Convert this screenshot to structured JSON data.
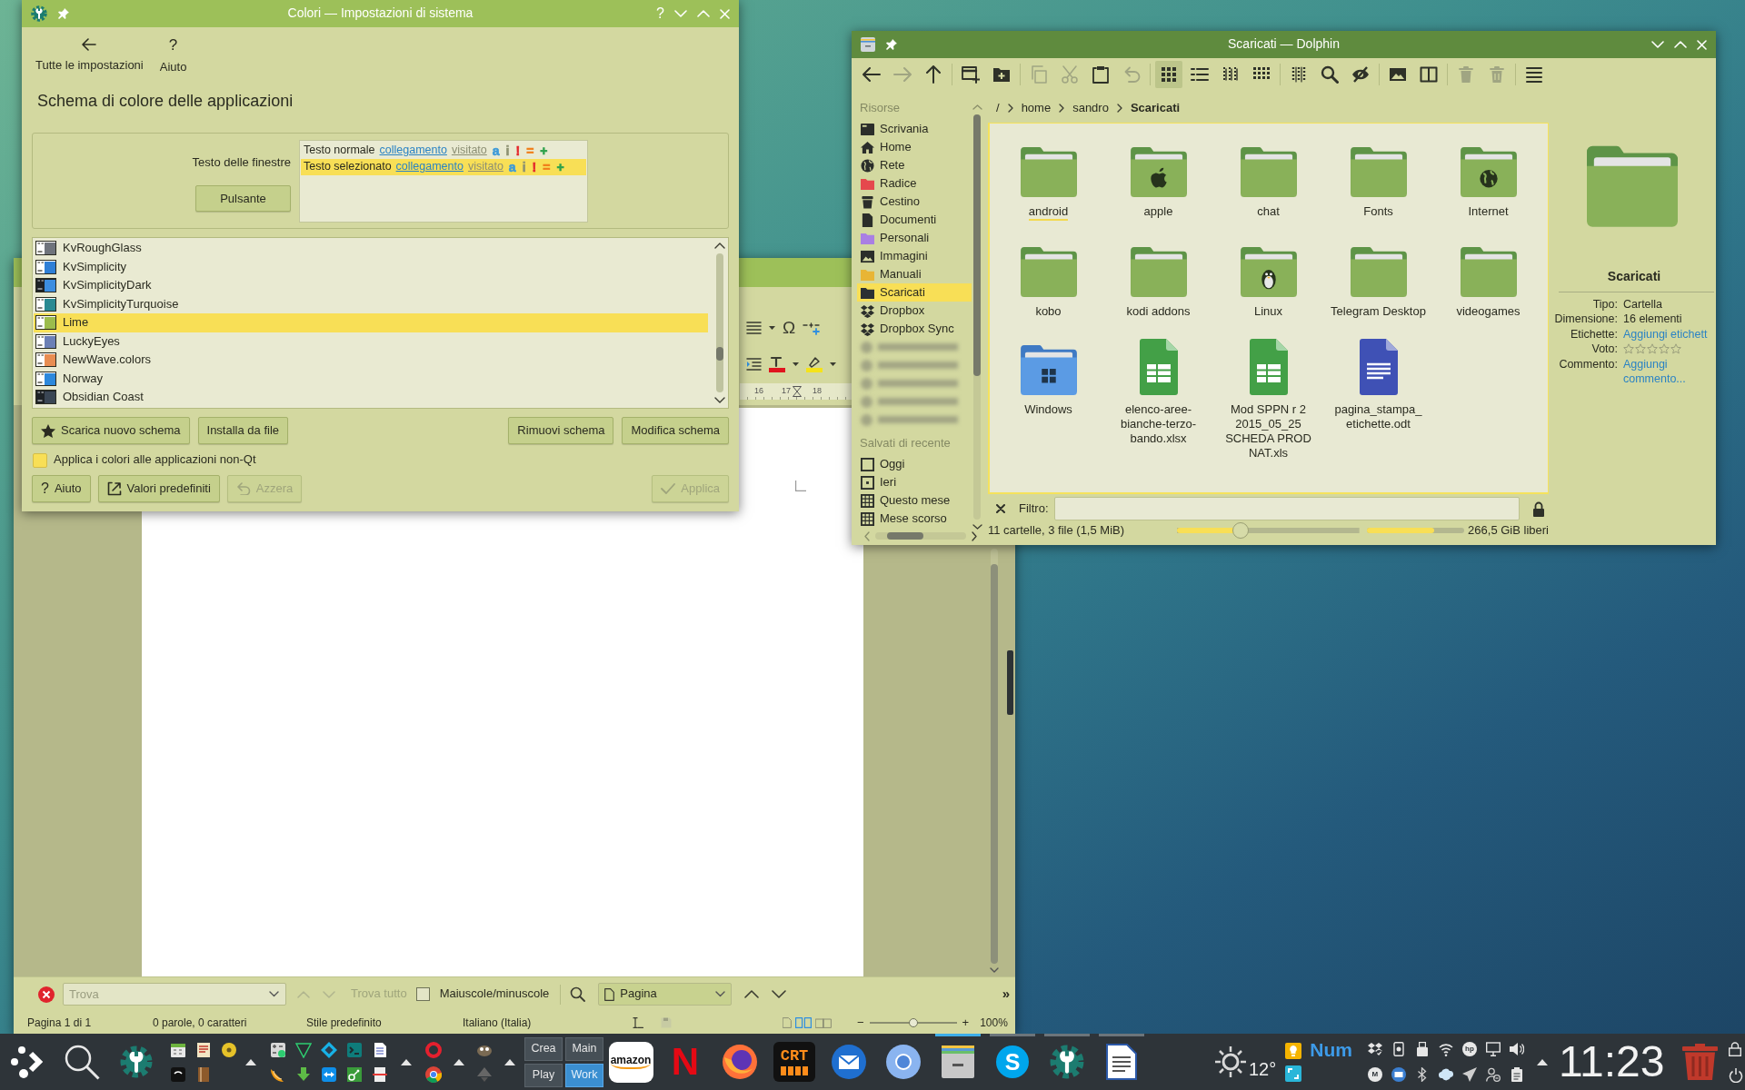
{
  "colors_window": {
    "title": "Colori — Impostazioni di sistema",
    "title_buttons": [
      {
        "kind": "help",
        "glyph": "?"
      },
      {
        "kind": "minimize"
      },
      {
        "kind": "maximize"
      },
      {
        "kind": "close"
      }
    ],
    "toolbar": [
      {
        "kind": "back",
        "label": "Tutte le impostazioni"
      },
      {
        "kind": "help",
        "glyph": "?",
        "label": "Aiuto"
      }
    ],
    "heading": "Schema di colore delle applicazioni",
    "preview": {
      "window_text_label": "Testo delle finestre",
      "button_label": "Pulsante",
      "rows": [
        {
          "selected": false,
          "text": "Testo normale",
          "link": "collegamento",
          "visited": "visitato",
          "marks": [
            {
              "text": "a",
              "color": "#3d9ad8"
            },
            {
              "text": "i",
              "color": "#8e9272"
            },
            {
              "text": "!",
              "color": "#e4282d"
            },
            {
              "text": "=",
              "color": "#f07f1b"
            },
            {
              "text": "+",
              "color": "#2fa24c"
            }
          ]
        },
        {
          "selected": true,
          "text": "Testo selezionato",
          "link": "collegamento",
          "visited": "visitato",
          "marks": [
            {
              "text": "a",
              "color": "#3d9ad8"
            },
            {
              "text": "i",
              "color": "#8e9272"
            },
            {
              "text": "!",
              "color": "#e4282d"
            },
            {
              "text": "=",
              "color": "#f07f1b"
            },
            {
              "text": "+",
              "color": "#2fa24c"
            }
          ]
        }
      ]
    },
    "schemes": [
      {
        "name": "KvRoughGlass",
        "color": "#6f747c",
        "dark": false,
        "selected": false
      },
      {
        "name": "KvSimplicity",
        "color": "#2f7fd6",
        "dark": false,
        "selected": false
      },
      {
        "name": "KvSimplicityDark",
        "color": "#3c8ee0",
        "dark": true,
        "selected": false
      },
      {
        "name": "KvSimplicityTurquoise",
        "color": "#2a8a92",
        "dark": false,
        "selected": false
      },
      {
        "name": "Lime",
        "color": "#9cbc4c",
        "dark": false,
        "selected": true
      },
      {
        "name": "LuckyEyes",
        "color": "#6c80b6",
        "dark": false,
        "selected": false
      },
      {
        "name": "NewWave.colors",
        "color": "#e88d52",
        "dark": false,
        "selected": false
      },
      {
        "name": "Norway",
        "color": "#2d88dc",
        "dark": false,
        "selected": false
      },
      {
        "name": "Obsidian Coast",
        "color": "#3a4654",
        "dark": true,
        "selected": false
      }
    ],
    "scheme_actions": {
      "left": [
        {
          "kind": "download",
          "label": "Scarica nuovo schema"
        },
        {
          "kind": "plain",
          "label": "Installa da file"
        }
      ],
      "right": [
        {
          "kind": "plain",
          "label": "Rimuovi schema"
        },
        {
          "kind": "plain",
          "label": "Modifica schema"
        }
      ]
    },
    "non_qt_option": {
      "label": "Applica i colori alle applicazioni non-Qt",
      "checked": false
    },
    "footer": {
      "left": [
        {
          "kind": "help",
          "glyph": "?",
          "label": "Aiuto",
          "disabled": false
        },
        {
          "kind": "defaults",
          "label": "Valori predefiniti",
          "disabled": false
        },
        {
          "kind": "reset",
          "label": "Azzera",
          "disabled": true
        }
      ],
      "right": [
        {
          "kind": "apply",
          "label": "Applica",
          "disabled": true
        }
      ]
    }
  },
  "dolphin_window": {
    "title": "Scaricati — Dolphin",
    "title_buttons": [
      {
        "kind": "minimize"
      },
      {
        "kind": "maximize"
      },
      {
        "kind": "close"
      }
    ],
    "toolbar": [
      {
        "kind": "back",
        "disabled": false,
        "selected": false
      },
      {
        "kind": "forward",
        "disabled": true,
        "selected": false
      },
      {
        "kind": "up",
        "disabled": false,
        "selected": false
      },
      {
        "kind": "separator"
      },
      {
        "kind": "newtab",
        "disabled": false,
        "selected": false
      },
      {
        "kind": "newfolder",
        "disabled": false,
        "selected": false
      },
      {
        "kind": "separator"
      },
      {
        "kind": "copy",
        "disabled": true,
        "selected": false
      },
      {
        "kind": "cut",
        "disabled": true,
        "selected": false
      },
      {
        "kind": "paste",
        "disabled": false,
        "selected": false
      },
      {
        "kind": "undo",
        "disabled": true,
        "selected": false
      },
      {
        "kind": "separator"
      },
      {
        "kind": "iconsview",
        "disabled": false,
        "selected": true
      },
      {
        "kind": "detailsview",
        "disabled": false,
        "selected": false
      },
      {
        "kind": "compactview",
        "disabled": false,
        "selected": false
      },
      {
        "kind": "gridview",
        "disabled": false,
        "selected": false
      },
      {
        "kind": "separator"
      },
      {
        "kind": "columns",
        "disabled": false,
        "selected": false
      },
      {
        "kind": "search",
        "disabled": false,
        "selected": false
      },
      {
        "kind": "hidden",
        "disabled": false,
        "selected": false
      },
      {
        "kind": "separator"
      },
      {
        "kind": "preview",
        "disabled": false,
        "selected": false
      },
      {
        "kind": "split",
        "disabled": false,
        "selected": false
      },
      {
        "kind": "separator"
      },
      {
        "kind": "trash",
        "disabled": true,
        "selected": false
      },
      {
        "kind": "delete",
        "disabled": true,
        "selected": false
      },
      {
        "kind": "separator"
      },
      {
        "kind": "menu",
        "disabled": false,
        "selected": false
      }
    ],
    "places": {
      "heading": "Risorse",
      "items": [
        {
          "kind": "desktop",
          "label": "Scrivania",
          "selected": false
        },
        {
          "kind": "home",
          "label": "Home",
          "selected": false
        },
        {
          "kind": "network",
          "label": "Rete",
          "selected": false
        },
        {
          "kind": "folder",
          "color": "#e5484d",
          "label": "Radice",
          "selected": false
        },
        {
          "kind": "trash",
          "label": "Cestino",
          "selected": false
        },
        {
          "kind": "document",
          "label": "Documenti",
          "selected": false
        },
        {
          "kind": "folder",
          "color": "#a97fe3",
          "label": "Personali",
          "selected": false
        },
        {
          "kind": "image",
          "label": "Immagini",
          "selected": false
        },
        {
          "kind": "folder",
          "color": "#e8b535",
          "label": "Manuali",
          "selected": false
        },
        {
          "kind": "folder",
          "color": "#2c3133",
          "label": "Scaricati",
          "selected": true
        },
        {
          "kind": "dropbox",
          "label": "Dropbox",
          "selected": false
        },
        {
          "kind": "dropbox",
          "label": "Dropbox Sync",
          "selected": false
        },
        {
          "kind": "blurred"
        },
        {
          "kind": "blurred"
        },
        {
          "kind": "blurred"
        },
        {
          "kind": "blurred"
        },
        {
          "kind": "blurred"
        }
      ]
    },
    "recent": {
      "heading": "Salvati di recente",
      "items": [
        {
          "kind": "today",
          "label": "Oggi",
          "selected": false
        },
        {
          "kind": "yesterday",
          "label": "Ieri",
          "selected": false
        },
        {
          "kind": "month",
          "label": "Questo mese",
          "selected": false
        },
        {
          "kind": "month",
          "label": "Mese scorso",
          "selected": false
        }
      ]
    },
    "breadcrumb": [
      {
        "label": "/",
        "selected": false
      },
      {
        "label": "home",
        "selected": false
      },
      {
        "label": "sandro",
        "selected": false
      },
      {
        "label": "Scaricati",
        "selected": true
      }
    ],
    "files": [
      {
        "name": "android",
        "kind": "folder",
        "focused": true
      },
      {
        "name": "apple",
        "kind": "apple",
        "focused": false
      },
      {
        "name": "chat",
        "kind": "folder",
        "focused": false
      },
      {
        "name": "Fonts",
        "kind": "folder",
        "focused": false
      },
      {
        "name": "Internet",
        "kind": "globe",
        "focused": false
      },
      {
        "name": "kobo",
        "kind": "folder",
        "focused": false
      },
      {
        "name": "kodi addons",
        "kind": "folder",
        "focused": false
      },
      {
        "name": "Linux",
        "kind": "penguin",
        "focused": false
      },
      {
        "name": "Telegram Desktop",
        "kind": "folder",
        "focused": false
      },
      {
        "name": "videogames",
        "kind": "folder",
        "focused": false
      },
      {
        "name": "Windows",
        "kind": "windows",
        "focused": false
      },
      {
        "name": "elenco-aree-bianche-terzo-bando.xlsx",
        "kind": "spreadsheet",
        "focused": false
      },
      {
        "name": "Mod SPPN r 2 2015_05_25 SCHEDA PROD NAT.xls",
        "kind": "spreadsheet",
        "focused": false
      },
      {
        "name": "pagina_stampa_etichette.odt",
        "kind": "document",
        "focused": false
      }
    ],
    "details": {
      "name": "Scaricati",
      "fields": [
        {
          "label": "Tipo:",
          "kind": "text",
          "value": "Cartella"
        },
        {
          "label": "Dimensione:",
          "kind": "text",
          "value": "16 elementi"
        },
        {
          "label": "Etichette:",
          "kind": "link",
          "value": "Aggiungi etichett"
        },
        {
          "label": "Voto:",
          "kind": "rating",
          "stars": 0
        },
        {
          "label": "Commento:",
          "kind": "link",
          "value": "Aggiungi commento..."
        }
      ]
    },
    "filter": {
      "label": "Filtro:"
    },
    "status_bar": {
      "text": "11 cartelle, 3 file (1,5 MiB)",
      "zoom_slider": {
        "level": 0.33
      },
      "free_space": {
        "level": 0.69,
        "reading": "266,5 GiB liberi"
      }
    }
  },
  "writer_window": {
    "toolbar": {
      "special_character": "Ω"
    },
    "ruler_labels": [
      "16",
      "17",
      "18"
    ],
    "find_bar": {
      "search": {
        "placeholder": "Trova"
      },
      "find_all": {
        "label": "Trova tutto",
        "disabled": true
      },
      "match_case": {
        "label": "Maiuscole/minuscole",
        "checked": false
      },
      "navigate_by": "Pagina",
      "more": "»"
    },
    "status_bar": {
      "page": "Pagina 1 di 1",
      "words": "0 parole, 0 caratteri",
      "style": "Stile predefinito",
      "language": "Italiano (Italia)",
      "zoom": {
        "out": "−",
        "in": "+",
        "level": 0.5,
        "reading": "100%"
      }
    }
  },
  "taskbar": {
    "pager": [
      {
        "label": "Crea",
        "selected": false
      },
      {
        "label": "Main",
        "selected": false
      },
      {
        "label": "Play",
        "selected": false
      },
      {
        "label": "Work",
        "selected": true
      }
    ],
    "tasks": [
      {
        "kind": "store",
        "logo": "amazon",
        "running": false,
        "active": false
      },
      {
        "kind": "streaming",
        "logo": "N",
        "running": false,
        "active": false
      },
      {
        "kind": "foxbrowser",
        "running": false,
        "active": false
      },
      {
        "kind": "terminal",
        "logo": "CRT",
        "running": false,
        "active": false
      },
      {
        "kind": "mail",
        "running": false,
        "active": false
      },
      {
        "kind": "browser",
        "running": false,
        "active": false
      },
      {
        "kind": "files",
        "running": true,
        "active": true
      },
      {
        "kind": "chat",
        "logo": "S",
        "running": true,
        "active": false
      },
      {
        "kind": "settings",
        "running": true,
        "active": false
      },
      {
        "kind": "writer",
        "running": true,
        "active": false
      }
    ],
    "weather": "12°",
    "num_lock": "Num",
    "tray": [
      {
        "kind": "dropbox"
      },
      {
        "kind": "phone"
      },
      {
        "kind": "usb"
      },
      {
        "kind": "wifi"
      },
      {
        "kind": "printer",
        "logo": "hp"
      },
      {
        "kind": "display"
      },
      {
        "kind": "volume"
      },
      {
        "kind": "mclient",
        "logo": "M"
      },
      {
        "kind": "mail"
      },
      {
        "kind": "bluetooth"
      },
      {
        "kind": "chat"
      },
      {
        "kind": "send"
      },
      {
        "kind": "user"
      },
      {
        "kind": "clipboard"
      }
    ],
    "clock": "11:23"
  }
}
